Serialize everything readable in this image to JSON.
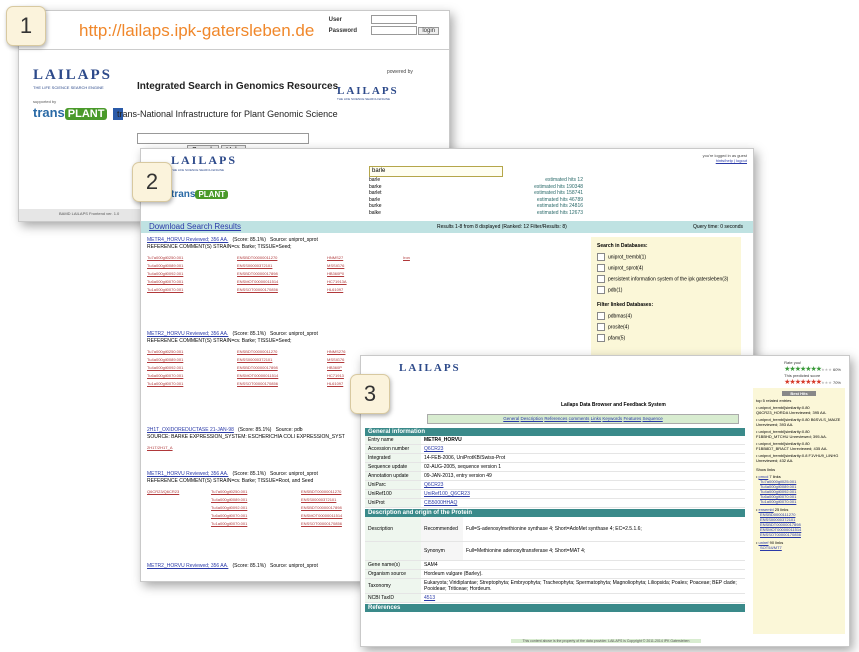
{
  "step_badges": [
    "1",
    "2",
    "3"
  ],
  "screen1": {
    "url": "http://lailaps.ipk-gatersleben.de",
    "user_label": "User",
    "password_label": "Password",
    "login_button": "login",
    "logo": "LAILAPS",
    "logo_tagline": "THE LIFE SCIENCE SEARCH ENGINE",
    "supported_label": "supported by",
    "trans_word": "trans",
    "plant_word": "PLANT",
    "powered_by": "powered by",
    "title": "Integrated Search in Genomics Resources",
    "subtitle": "trans-National Infrastructure for Plant Genomic Science",
    "search_button": "Search",
    "help_button": "Help",
    "footer": "BAMD LAILAPS Frontend ver. 1.0"
  },
  "screen2": {
    "logo": "LAILAPS",
    "logo_tagline": "THE LIFE SCIENCE SEARCH ENGINE",
    "query": "barle",
    "top_right_line1": "you're logged in as guest",
    "top_right_line2": "hints/help | logout",
    "suggestions": [
      {
        "term": "barle",
        "hits": "estimated hits 12"
      },
      {
        "term": "barke",
        "hits": "estimated hits 190348"
      },
      {
        "term": "barlet",
        "hits": "estimated hits 158741"
      },
      {
        "term": "barle",
        "hits": "estimated hits 46789"
      },
      {
        "term": "burke",
        "hits": "estimated hits 24816"
      },
      {
        "term": "balke",
        "hits": "estimated hits 12673"
      }
    ],
    "download_link": "Download Search Results",
    "results_summary": "Results 1-8 from 8 displayed (Ranked: 12 Filter/Results: 8)",
    "query_time": "Query time: 0 seconds",
    "results": [
      {
        "title": "METR4_HORVU Reviewed; 356 AA.",
        "score": "(Score: 85.1%)",
        "source": "Source: uniprot_sprot",
        "desc": "REFERENCE COMMENT(S) STRAIN=cv. Barke; TISSUE=Seed;"
      },
      {
        "title": "METR2_HORVU Reviewed; 356 AA.",
        "score": "(Score: 85.1%)",
        "source": "Source: uniprot_sprot",
        "desc": "REFERENCE COMMENT(S) STRAIN=cv. Barke; TISSUE=Seed;"
      },
      {
        "title": "2H1T_OXIDOREDUCTASE 21-JAN-98",
        "score": "(Score: 85.1%)",
        "source": "Source: pdb",
        "desc": "SOURCE: BARKE EXPRESSION_SYSTEM: ESCHERICHIA COLI EXPRESSION_SYST"
      },
      {
        "title": "METR1_HORVU Reviewed; 356 AA.",
        "score": "(Score: 85.1%)",
        "source": "Source: uniprot_sprot",
        "desc": "REFERENCE COMMENT(S) STRAIN=cv. Barke; TISSUE=Root, and Seed"
      },
      {
        "title": "METR2_HORVU Reviewed; 356 AA.",
        "score": "(Score: 85.1%)",
        "source": "Source: uniprot_sprot",
        "desc": ""
      }
    ],
    "search_in_db_title": "Search in Databases:",
    "databases": [
      "uniprot_trembl(1)",
      "uniprot_sprot(4)",
      "persistent information system of the ipk gatersleben(3)",
      "pdb(1)"
    ],
    "filter_linked_title": "Filter linked Databases:",
    "linked_filters": [
      "pdbmas(4)",
      "prosite(4)",
      "pfam(5)"
    ]
  },
  "screen3": {
    "logo": "LAILAPS",
    "rate_label": "Rate you!",
    "rate_pct": "60%",
    "predict_label": "This predicted score",
    "predict_pct": "70%",
    "page_title": "Lailaps Data Browser and Feedback System",
    "tabs": [
      "General",
      "Description",
      "References",
      "comments",
      "Links",
      "Keywords",
      "Features",
      "Sequence"
    ],
    "general_header": "General information",
    "fields": [
      {
        "label": "Entry name",
        "value": "METR4_HORVU"
      },
      {
        "label": "Accession number",
        "value": "Q6CR23"
      },
      {
        "label": "Integrated",
        "value": "14-FEB-2006, UniProtKB/Swiss-Prot"
      },
      {
        "label": "Sequence update",
        "value": "02-AUG-2005, sequence version 1"
      },
      {
        "label": "Annotation update",
        "value": "09-JAN-2013, entry version 49"
      },
      {
        "label": "UniParc",
        "value": "Q6CR23"
      },
      {
        "label": "UniRef100",
        "value": "UniRef100_Q6CR23"
      },
      {
        "label": "UniProt",
        "value": "CI55000HHAQ"
      }
    ],
    "desc_header": "Description and origin of the Protein",
    "desc_rows": [
      {
        "label": "Description",
        "sub": "Recommended",
        "value": "Full=S-adenosylmethionine synthase 4; Short=AdoMet synthase 4; EC=2.5.1.6;"
      },
      {
        "label": "",
        "sub": "Synonym",
        "value": "Full=Methionine adenosyltransferase 4; Short=MAT 4;"
      },
      {
        "label": "Gene name(s)",
        "sub": "",
        "value": "SAM4"
      },
      {
        "label": "Organism source",
        "sub": "",
        "value": "Hordeum vulgare (Barley)."
      },
      {
        "label": "Taxonomy",
        "sub": "",
        "value": "Eukaryota; Viridiplantae; Streptophyta; Embryophyta; Tracheophyta; Spermatophyta; Magnoliophyta; Liliopsida; Poales; Poaceae; BEP clade; Pooideae; Triticeae; Hordeum."
      },
      {
        "label": "NCBI TaxID",
        "sub": "",
        "value": "4513"
      }
    ],
    "references_header": "References",
    "side_button": "Best Hits",
    "side_top": "top 5 related entries",
    "related": [
      "uniprot_trembl[similarity:0.80 Q6CR23_HORDA Unreviewed; 395 AA.",
      "uniprot_trembl[similarity:0.80 B6SVLS_MAIZE Unreviewed; 393 AA.",
      "uniprot_trembl[similarity:0.80 F1BBHD_MTCHU Unreviewed; 395 AA.",
      "uniprot_trembl[similarity:0.80 F1BB8D7_BRACT Unreviewed; 435 AA.",
      "uniprot_trembl[similarity:0.8 F1VHU9_LINHG Unreviewed; 432 AA."
    ],
    "show_links": "Show links",
    "link_groups": [
      {
        "name": "pmcd",
        "count": "7 links",
        "items": [
          "Tu7a0000gil025.001",
          "Tu4a000gil0089.001",
          "Tu4a000gil0092.001",
          "Tu6a000gil0070.001",
          "Tu1a000gil0070.001"
        ]
      },
      {
        "name": "ensembl",
        "count": "25 links",
        "items": [
          "ENSBD0000111270",
          "ENSS00000372101",
          "ENSBDT00000017898",
          "ENSMOT00000011514",
          "ENSSOT00000170856"
        ]
      },
      {
        "name": "uniref",
        "count": "90 links",
        "items": [
          "SOT54/MT7"
        ]
      }
    ],
    "footer": "This content above is the property of the data provider. LAILAPS is Copyright © 2011-2014 IPK Gatersleben"
  }
}
